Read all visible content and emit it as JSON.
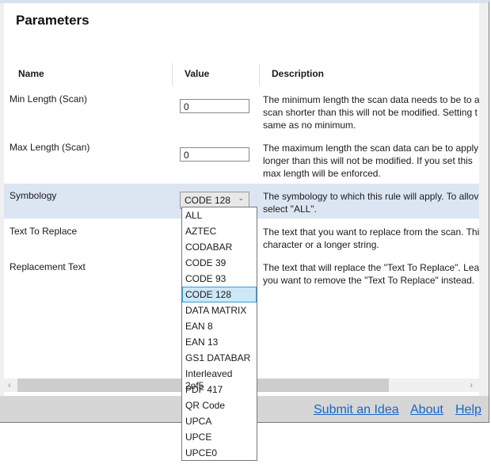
{
  "title": "Parameters",
  "columns": {
    "name": "Name",
    "value": "Value",
    "description": "Description"
  },
  "rows": [
    {
      "name": "Min Length (Scan)",
      "value": "0",
      "description": [
        "The minimum length the scan data needs to be to a",
        "scan shorter than this will not be modified. Setting t",
        "same as no minimum."
      ]
    },
    {
      "name": "Max Length (Scan)",
      "value": "0",
      "description": [
        "The maximum length the scan data can be to apply",
        "longer than this will not be modified. If you set this",
        "max length will be enforced."
      ]
    },
    {
      "name": "Symbology",
      "value": "CODE 128",
      "description": [
        "The symbology to which this rule will apply. To allov",
        "select \"ALL\"."
      ]
    },
    {
      "name": "Text To Replace",
      "description": [
        "The text that you want to replace from the scan. Thi",
        "character or a longer string."
      ]
    },
    {
      "name": "Replacement Text",
      "description": [
        "The text that will replace the \"Text To Replace\". Leav",
        "you want to remove the \"Text To Replace\" instead."
      ]
    }
  ],
  "symbology_options": [
    "ALL",
    "AZTEC",
    "CODABAR",
    "CODE 39",
    "CODE 93",
    "CODE 128",
    "DATA MATRIX",
    "EAN 8",
    "EAN 13",
    "GS1 DATABAR",
    "Interleaved 2of5",
    "PDF 417",
    "QR Code",
    "UPCA",
    "UPCE",
    "UPCE0"
  ],
  "selected_option": "CODE 128",
  "footer": {
    "submit": "Submit an Idea",
    "about": "About",
    "help": "Help"
  },
  "colors": {
    "selected_row": "#dce6f2",
    "link": "#1a66cc",
    "highlight": "#cce8f6"
  }
}
